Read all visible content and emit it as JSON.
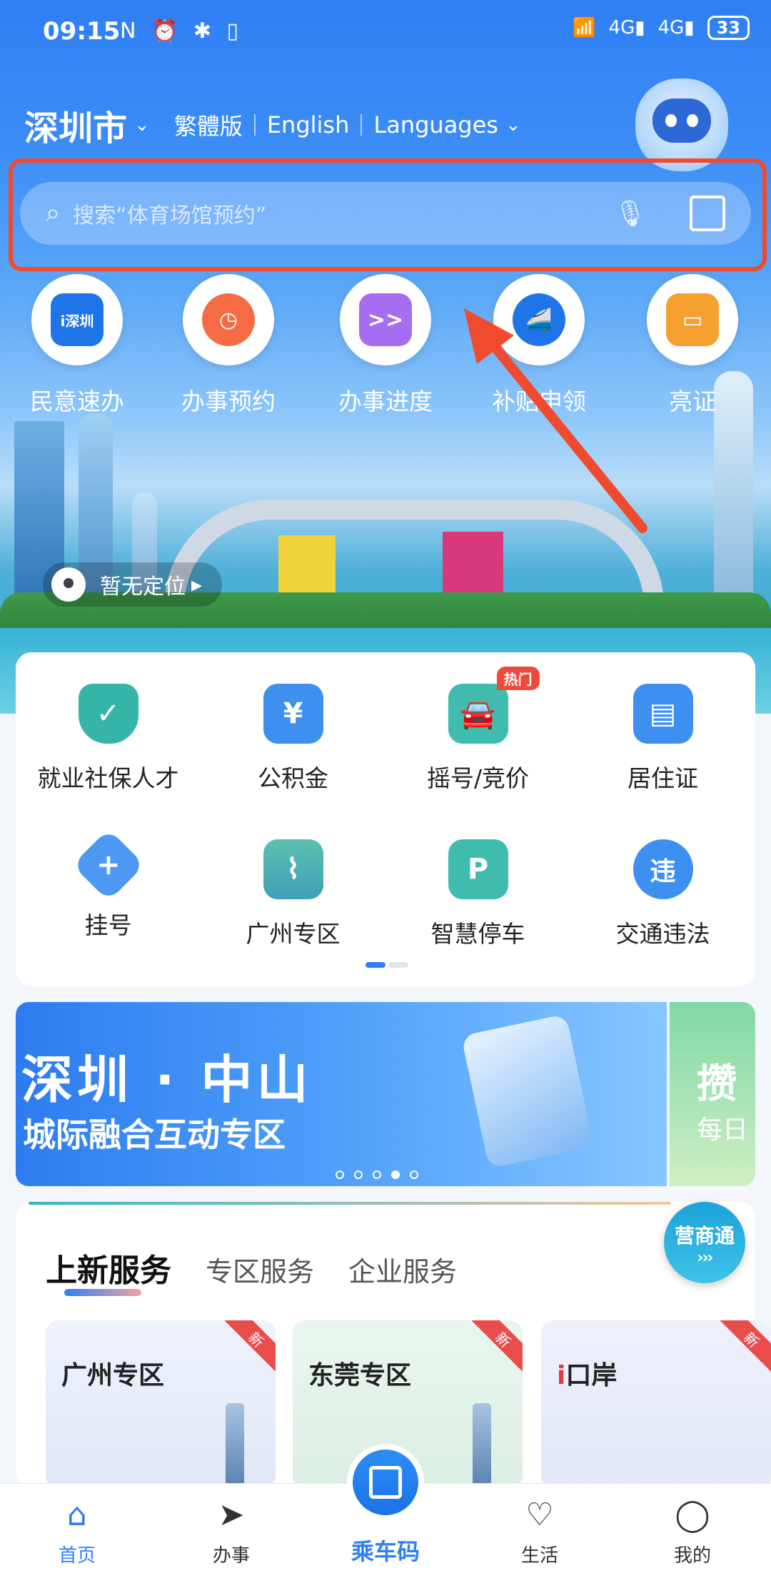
{
  "status_bar": {
    "time": "09:15",
    "battery": "33",
    "network": "4G"
  },
  "header": {
    "city": "深圳市",
    "lang_traditional": "繁體版",
    "lang_english": "English",
    "lang_languages": "Languages"
  },
  "search": {
    "placeholder": "搜索“体育场馆预约”"
  },
  "quick_actions": [
    {
      "label": "民意速办",
      "icon": "i深圳"
    },
    {
      "label": "办事预约",
      "icon": "clock"
    },
    {
      "label": "办事进度",
      "icon": ">>"
    },
    {
      "label": "补贴申领",
      "icon": "train"
    },
    {
      "label": "亮证",
      "icon": "wallet"
    }
  ],
  "location": {
    "text": "暂无定位"
  },
  "services_grid": [
    {
      "label": "就业社保人才",
      "icon": "shield-check"
    },
    {
      "label": "公积金",
      "icon": "house-yen"
    },
    {
      "label": "摇号/竞价",
      "icon": "car",
      "badge": "热门"
    },
    {
      "label": "居住证",
      "icon": "id-card"
    },
    {
      "label": "挂号",
      "icon": "plus"
    },
    {
      "label": "广州专区",
      "icon": "tower"
    },
    {
      "label": "智慧停车",
      "icon": "parking"
    },
    {
      "label": "交通违法",
      "icon": "违"
    }
  ],
  "banner": {
    "title": "深圳 · 中山",
    "subtitle": "城际融合互动专区",
    "side_title": "攒",
    "side_sub": "每日"
  },
  "tabs": {
    "active": "上新服务",
    "items": [
      "专区服务",
      "企业服务"
    ]
  },
  "floating": {
    "label": "营商通",
    "chevrons": "›››"
  },
  "service_cards": [
    {
      "name": "广州专区",
      "tag": "新"
    },
    {
      "name": "东莞专区",
      "tag": "新"
    },
    {
      "name": "口岸",
      "tag": "新",
      "prefix": "i"
    }
  ],
  "nav": [
    {
      "label": "首页",
      "active": true
    },
    {
      "label": "办事"
    },
    {
      "label": "乘车码"
    },
    {
      "label": "生活"
    },
    {
      "label": "我的"
    }
  ],
  "colors": {
    "accent": "#2f7ff4",
    "highlight": "#f04b2e"
  }
}
